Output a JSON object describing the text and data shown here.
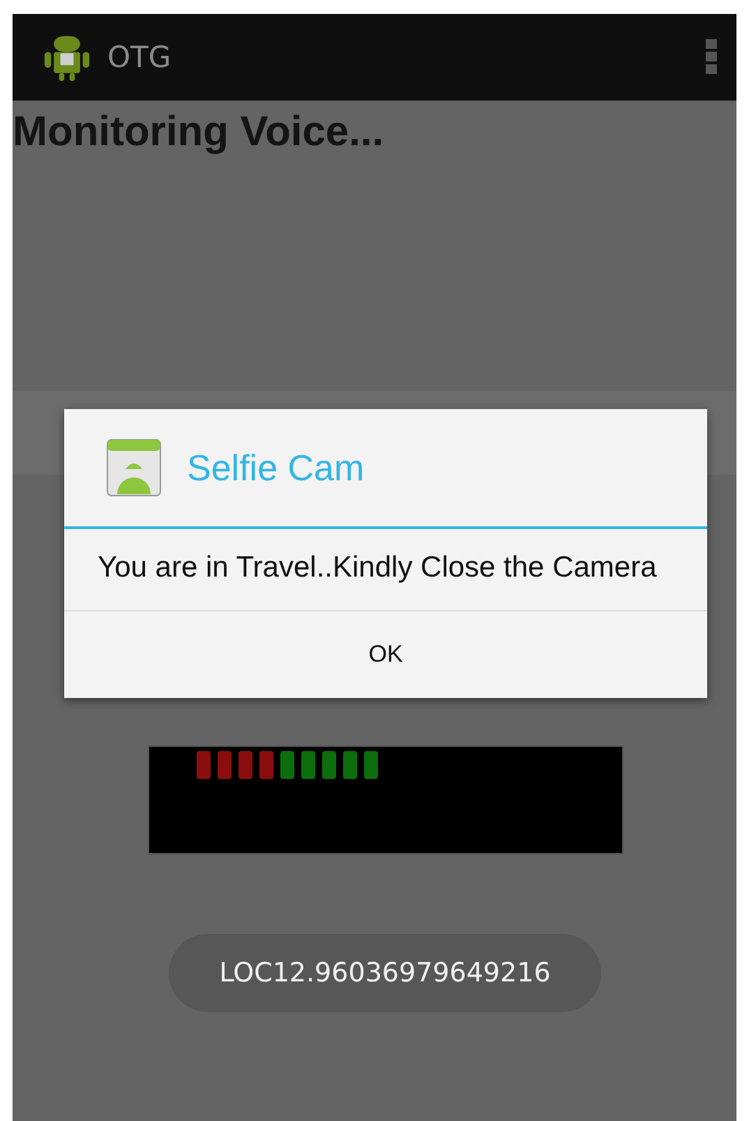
{
  "action_bar": {
    "title": "OTG"
  },
  "heading": "Monitoring Voice...",
  "meter": {
    "level": 0.5
  },
  "dialog": {
    "title": "Selfie Cam",
    "message": "You are in Travel..Kindly Close the Camera",
    "buttons": [
      "OK"
    ]
  },
  "toast": "LOC12.96036979649216"
}
